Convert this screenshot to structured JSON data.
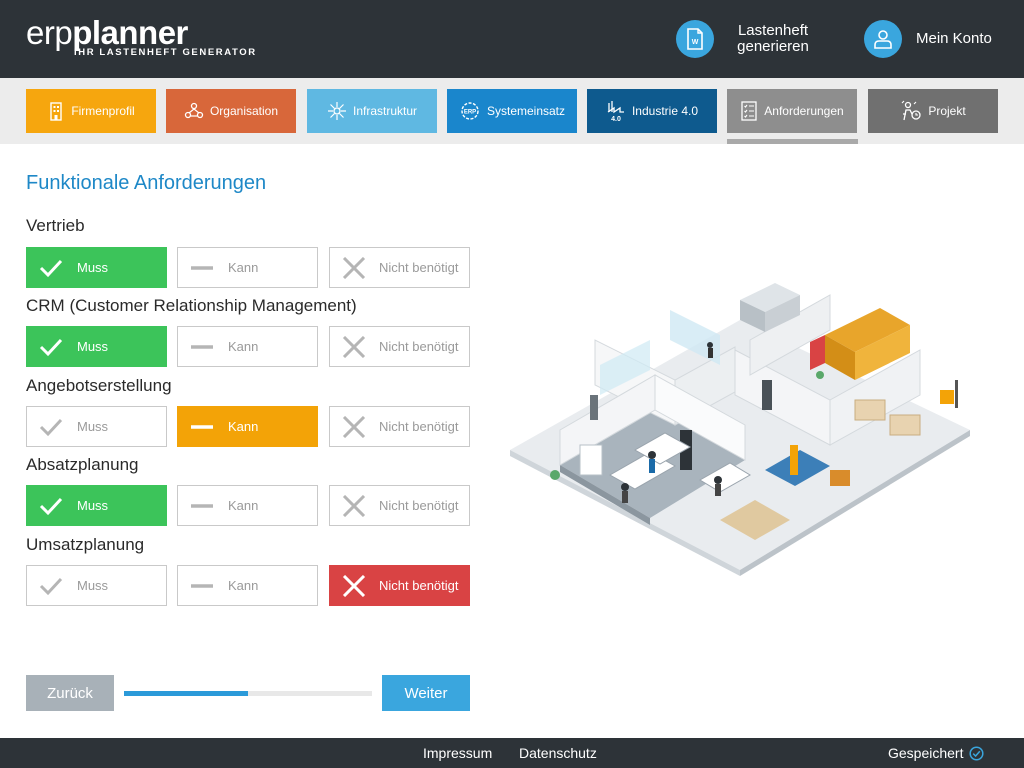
{
  "brand": {
    "logo_part1": "erp",
    "logo_part2": "planner",
    "tagline": "IHR LASTENHEFT GENERATOR"
  },
  "header": {
    "lastenheft_line1": "Lastenheft",
    "lastenheft_line2": "generieren",
    "account_label": "Mein Konto"
  },
  "tabs": [
    {
      "label": "Firmenprofil",
      "color": "#f6a60e",
      "icon": "building-icon"
    },
    {
      "label": "Organisation",
      "color": "#d8673a",
      "icon": "org-people-icon"
    },
    {
      "label": "Infrastruktur",
      "color": "#5fb8e2",
      "icon": "network-icon"
    },
    {
      "label": "Systemeinsatz",
      "color": "#1a86cc",
      "icon": "erp-gear-icon"
    },
    {
      "label": "Industrie 4.0",
      "color": "#0e5a8e",
      "icon": "factory-icon"
    },
    {
      "label": "Anforderungen",
      "color": "#8e8e8e",
      "icon": "checklist-icon",
      "active": true
    },
    {
      "label": "Projekt",
      "color": "#707070",
      "icon": "project-worker-icon"
    }
  ],
  "main": {
    "section_title": "Funktionale Anforderungen",
    "options": {
      "muss": "Muss",
      "kann": "Kann",
      "nicht": "Nicht benötigt"
    },
    "requirements": [
      {
        "label": "Vertrieb",
        "selected": "muss"
      },
      {
        "label": "CRM (Customer Relationship Management)",
        "selected": "muss"
      },
      {
        "label": "Angebotserstellung",
        "selected": "kann"
      },
      {
        "label": "Absatzplanung",
        "selected": "muss"
      },
      {
        "label": "Umsatzplanung",
        "selected": "nicht"
      }
    ]
  },
  "navigation": {
    "back_label": "Zurück",
    "next_label": "Weiter",
    "progress_percent": 50
  },
  "footer": {
    "impressum": "Impressum",
    "datenschutz": "Datenschutz",
    "saved_status": "Gespeichert"
  },
  "colors": {
    "header_bg": "#2d3338",
    "accent_blue": "#3aa6de",
    "title_blue": "#1e88c7",
    "muss_green": "#3cc45a",
    "kann_orange": "#f3a307",
    "nicht_red": "#d94344"
  }
}
